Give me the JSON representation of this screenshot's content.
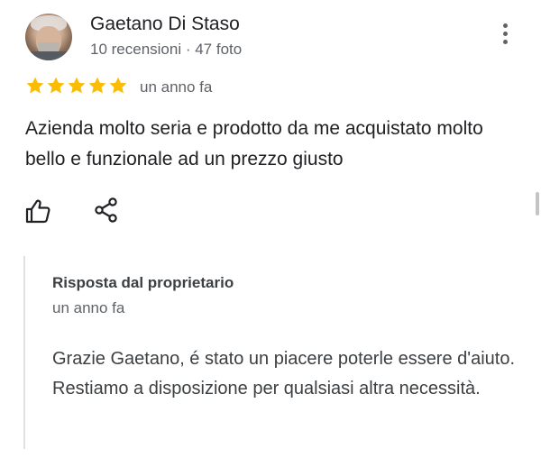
{
  "review": {
    "author_name": "Gaetano Di Staso",
    "author_meta": "10 recensioni · 47 foto",
    "rating": 5,
    "rating_max": 5,
    "date": "un anno fa",
    "text": "Azienda molto seria e prodotto da me acquistato molto bello e funzionale ad un prezzo giusto",
    "icons": {
      "avatar": "profile-photo",
      "more": "more-vert-icon",
      "like": "thumb-up-icon",
      "share": "share-icon",
      "star": "star-icon"
    },
    "colors": {
      "star": "#fbbc04",
      "text": "#202124",
      "secondary": "#5f6368"
    }
  },
  "owner_reply": {
    "title": "Risposta dal proprietario",
    "date": "un anno fa",
    "text": "Grazie Gaetano, é stato un piacere poterle essere d'aiuto. Restiamo a disposizione per qualsiasi altra necessità."
  }
}
